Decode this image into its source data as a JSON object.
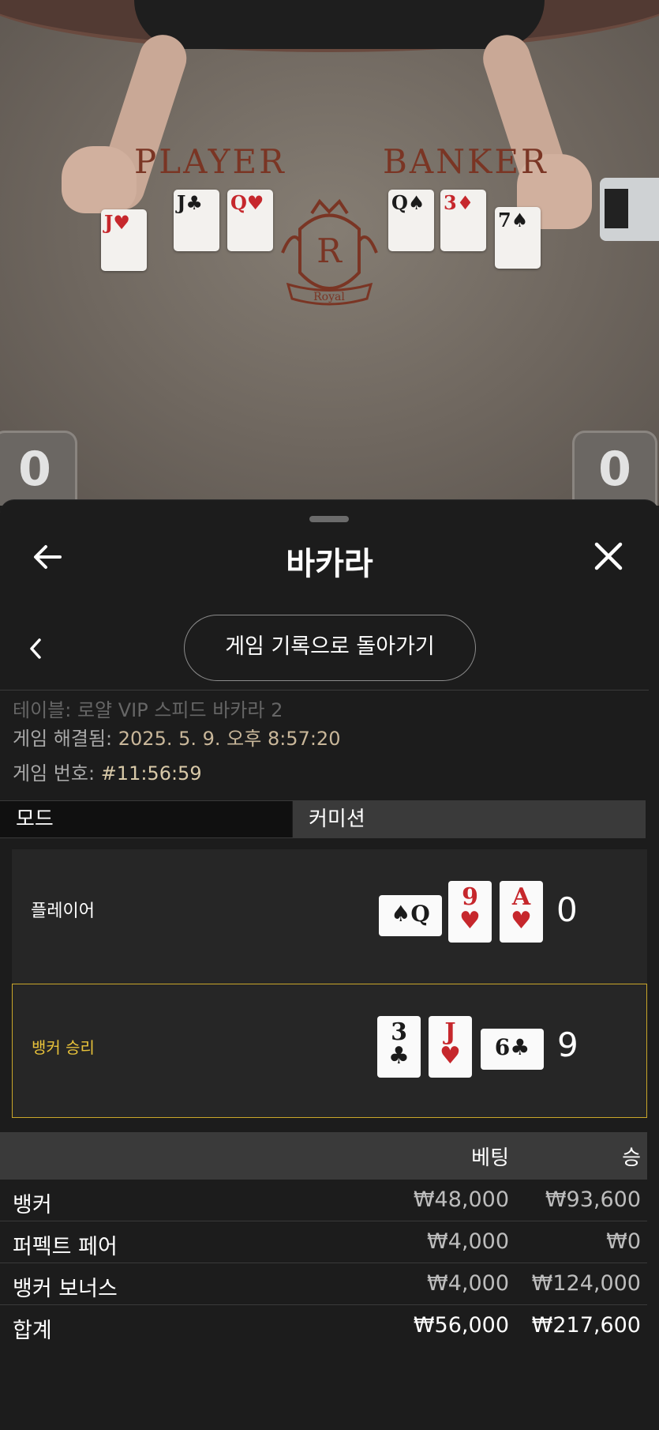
{
  "video": {
    "player_label": "PLAYER",
    "banker_label": "BANKER",
    "crest_letter": "R",
    "crest_text": "Royal",
    "player_score": "0",
    "banker_score": "0",
    "table_cards": {
      "player": [
        {
          "rank": "J",
          "suit": "♥",
          "color": "red"
        },
        {
          "rank": "J",
          "suit": "♣",
          "color": "blk"
        },
        {
          "rank": "Q",
          "suit": "♥",
          "color": "red"
        }
      ],
      "banker": [
        {
          "rank": "Q",
          "suit": "♠",
          "color": "blk"
        },
        {
          "rank": "3",
          "suit": "♦",
          "color": "red"
        },
        {
          "rank": "7",
          "suit": "♠",
          "color": "blk"
        }
      ]
    }
  },
  "header": {
    "title": "바카라",
    "back_icon": "arrow-left-icon",
    "close_icon": "close-icon"
  },
  "history_button": "게임 기록으로 돌아가기",
  "info": {
    "table_line": "테이블: 로얄 VIP 스피드 바카라 2",
    "resolved_label": "게임 해결됨:",
    "resolved_value": "2025. 5. 9. 오후 8:57:20",
    "number_label": "게임 번호:",
    "number_value": "#11:56:59"
  },
  "tabs": {
    "mode": "모드",
    "commission": "커미션"
  },
  "hands": {
    "player": {
      "label": "플레이어",
      "score": "0",
      "cards": [
        {
          "rank": "Q",
          "suit": "♠",
          "color": "blk",
          "orient": "h"
        },
        {
          "rank": "9",
          "suit": "♥",
          "color": "red",
          "orient": "v"
        },
        {
          "rank": "A",
          "suit": "♥",
          "color": "red",
          "orient": "v"
        }
      ]
    },
    "banker": {
      "label": "뱅커 승리",
      "score": "9",
      "cards": [
        {
          "rank": "3",
          "suit": "♣",
          "color": "blk",
          "orient": "v"
        },
        {
          "rank": "J",
          "suit": "♥",
          "color": "red",
          "orient": "v"
        },
        {
          "rank": "6",
          "suit": "♣",
          "color": "blk",
          "orient": "h"
        }
      ]
    }
  },
  "bets": {
    "head_bet": "베팅",
    "head_win": "승",
    "rows": [
      {
        "name": "뱅커",
        "bet": "₩48,000",
        "win": "₩93,600"
      },
      {
        "name": "퍼펙트 페어",
        "bet": "₩4,000",
        "win": "₩0"
      },
      {
        "name": "뱅커 보너스",
        "bet": "₩4,000",
        "win": "₩124,000"
      }
    ],
    "total": {
      "name": "합계",
      "bet": "₩56,000",
      "win": "₩217,600"
    }
  },
  "colors": {
    "sheet_bg": "#1c1c1c",
    "winner_border": "#c9a62a",
    "winner_label": "#e8c23a",
    "card_red": "#c6272c"
  }
}
